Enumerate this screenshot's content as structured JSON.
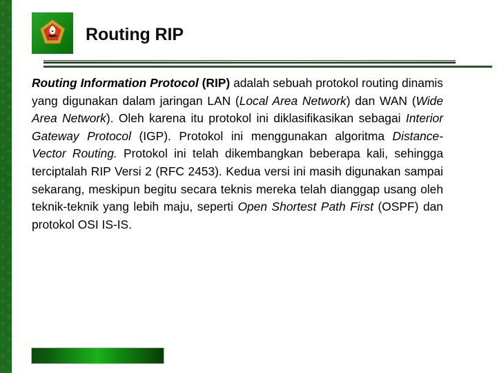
{
  "slide": {
    "title": "Routing RIP",
    "logo": {
      "name": "university-emblem",
      "shape": "pentagon",
      "colors": {
        "background": "#1a911a",
        "ring": "#c8a030",
        "inner": "#c32020",
        "center": "#f4f0e4"
      }
    },
    "accent_colors": {
      "strip_green": "#1d6b1d",
      "rule_dark": "#1c4a1c",
      "rule_bright": "#3fd43f",
      "bar_bright": "#19b319",
      "bar_dark": "#083a08",
      "title_text": "#0d0d0d",
      "body_text": "#000000"
    },
    "body": {
      "segments": [
        {
          "text": "Routing Information Protocol",
          "style": "bold-italic"
        },
        {
          "text": " ",
          "style": "normal"
        },
        {
          "text": "(RIP)",
          "style": "bold"
        },
        {
          "text": " adalah sebuah protokol routing dinamis yang digunakan dalam jaringan LAN (",
          "style": "normal"
        },
        {
          "text": "Local Area Network",
          "style": "italic"
        },
        {
          "text": ") dan WAN (",
          "style": "normal"
        },
        {
          "text": "Wide Area Network",
          "style": "italic"
        },
        {
          "text": "). Oleh karena itu protokol ini diklasifikasikan sebagai ",
          "style": "normal"
        },
        {
          "text": "Interior Gateway Protocol",
          "style": "italic"
        },
        {
          "text": " (IGP). Protokol ini menggunakan algoritma ",
          "style": "normal"
        },
        {
          "text": "Distance-Vector Routing.",
          "style": "italic"
        },
        {
          "text": " Protokol ini telah dikembangkan beberapa kali, sehingga terciptalah RIP Versi 2 (RFC 2453). Kedua versi ini masih digunakan sampai sekarang, meskipun begitu secara teknis mereka telah dianggap usang oleh teknik-teknik yang lebih maju, seperti ",
          "style": "normal"
        },
        {
          "text": "Open Shortest Path First",
          "style": "italic"
        },
        {
          "text": " (OSPF) dan protokol OSI IS-IS.",
          "style": "normal"
        }
      ]
    }
  }
}
